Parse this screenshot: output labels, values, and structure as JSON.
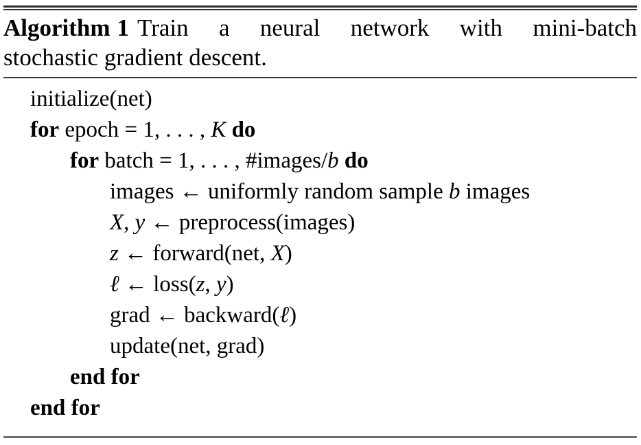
{
  "document": {
    "kind": "algorithm-float",
    "colors": {
      "text": "#000000",
      "rule": "#2b2b2b",
      "rule_bottom": "#6e6e6e",
      "background": "#ffffff"
    }
  },
  "caption": {
    "label": "Algorithm",
    "number": "1",
    "description": "Train a neural network with mini-batch stochastic gradient descent.",
    "line_1": "Train a neural network with mini-batch",
    "line_2": "stochastic gradient descent.",
    "full_text": "Algorithm 1 Train a neural network with mini-batch stochastic gradient descent."
  },
  "body": {
    "lines": [
      {
        "id": "line-initialize",
        "indent": 1,
        "text": "initialize(net)",
        "tokens": [
          {
            "t": "initialize(net)",
            "style": "plain"
          }
        ]
      },
      {
        "id": "line-for-epoch",
        "indent": 1,
        "text": "for epoch = 1, . . . , K do",
        "tokens": [
          {
            "t": "for",
            "style": "keyword"
          },
          {
            "t": " epoch ",
            "style": "plain"
          },
          {
            "t": "=",
            "style": "operator"
          },
          {
            "t": " 1",
            "style": "number"
          },
          {
            "t": ", . . . , ",
            "style": "plain"
          },
          {
            "t": "K",
            "style": "variable"
          },
          {
            "t": " ",
            "style": "plain"
          },
          {
            "t": "do",
            "style": "keyword"
          }
        ]
      },
      {
        "id": "line-for-batch",
        "indent": 2,
        "text": "for batch = 1, . . . , #images/b do",
        "tokens": [
          {
            "t": "for",
            "style": "keyword"
          },
          {
            "t": " batch ",
            "style": "plain"
          },
          {
            "t": "=",
            "style": "operator"
          },
          {
            "t": " 1",
            "style": "number"
          },
          {
            "t": ", . . . , ",
            "style": "plain"
          },
          {
            "t": "#images",
            "style": "plain"
          },
          {
            "t": "/",
            "style": "operator"
          },
          {
            "t": "b",
            "style": "variable"
          },
          {
            "t": " ",
            "style": "plain"
          },
          {
            "t": "do",
            "style": "keyword"
          }
        ]
      },
      {
        "id": "line-sample-images",
        "indent": 3,
        "text": "images ← uniformly random sample b images",
        "tokens": [
          {
            "t": "images ",
            "style": "plain"
          },
          {
            "t": "←",
            "style": "operator"
          },
          {
            "t": " uniformly random sample ",
            "style": "plain"
          },
          {
            "t": "b",
            "style": "variable"
          },
          {
            "t": " images",
            "style": "plain"
          }
        ]
      },
      {
        "id": "line-preprocess",
        "indent": 3,
        "text": "X, y ← preprocess(images)",
        "tokens": [
          {
            "t": "X",
            "style": "variable"
          },
          {
            "t": ", ",
            "style": "plain"
          },
          {
            "t": "y",
            "style": "variable"
          },
          {
            "t": " ",
            "style": "plain"
          },
          {
            "t": "←",
            "style": "operator"
          },
          {
            "t": " preprocess(images)",
            "style": "plain"
          }
        ]
      },
      {
        "id": "line-forward",
        "indent": 3,
        "text": "z ← forward(net, X)",
        "tokens": [
          {
            "t": "z",
            "style": "variable"
          },
          {
            "t": " ",
            "style": "plain"
          },
          {
            "t": "←",
            "style": "operator"
          },
          {
            "t": " forward(net, ",
            "style": "plain"
          },
          {
            "t": "X",
            "style": "variable"
          },
          {
            "t": ")",
            "style": "plain"
          }
        ]
      },
      {
        "id": "line-loss",
        "indent": 3,
        "text": "ℓ ← loss(z, y)",
        "tokens": [
          {
            "t": "ℓ",
            "style": "variable"
          },
          {
            "t": " ",
            "style": "plain"
          },
          {
            "t": "←",
            "style": "operator"
          },
          {
            "t": " loss(",
            "style": "plain"
          },
          {
            "t": "z",
            "style": "variable"
          },
          {
            "t": ", ",
            "style": "plain"
          },
          {
            "t": "y",
            "style": "variable"
          },
          {
            "t": ")",
            "style": "plain"
          }
        ]
      },
      {
        "id": "line-backward",
        "indent": 3,
        "text": "grad ← backward(ℓ)",
        "tokens": [
          {
            "t": "grad ",
            "style": "plain"
          },
          {
            "t": "←",
            "style": "operator"
          },
          {
            "t": " backward(",
            "style": "plain"
          },
          {
            "t": "ℓ",
            "style": "variable"
          },
          {
            "t": ")",
            "style": "plain"
          }
        ]
      },
      {
        "id": "line-update",
        "indent": 3,
        "text": "update(net, grad)",
        "tokens": [
          {
            "t": "update(net, grad)",
            "style": "plain"
          }
        ]
      },
      {
        "id": "line-end-for-inner",
        "indent": 2,
        "text": "end for",
        "tokens": [
          {
            "t": "end for",
            "style": "keyword"
          }
        ]
      },
      {
        "id": "line-end-for-outer",
        "indent": 1,
        "text": "end for",
        "tokens": [
          {
            "t": "end for",
            "style": "keyword"
          }
        ]
      }
    ]
  }
}
